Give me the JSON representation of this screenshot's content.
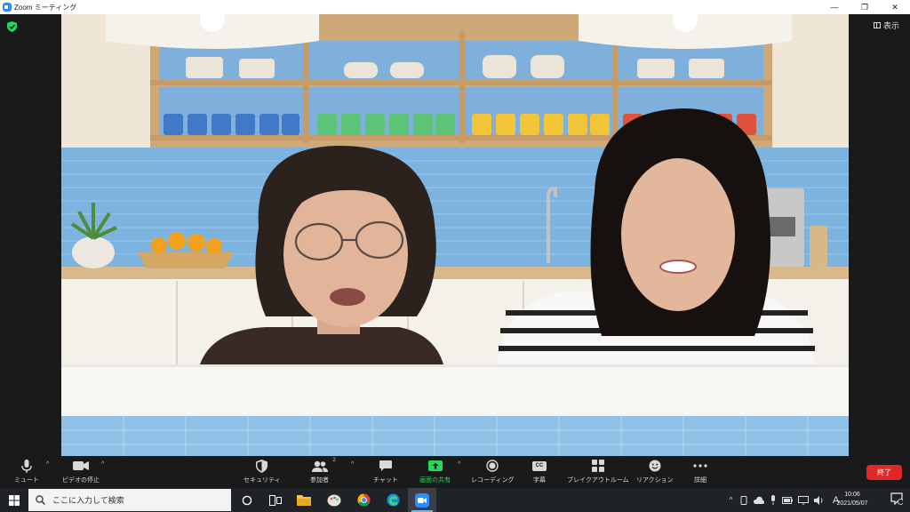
{
  "window": {
    "title": "Zoom ミーティング",
    "minimize": "—",
    "maximize": "❐",
    "close": "✕"
  },
  "meeting": {
    "view_label": "表示",
    "secure_icon": "shield-check-icon"
  },
  "toolbar": {
    "mute": "ミュート",
    "video_stop": "ビデオの停止",
    "security": "セキュリティ",
    "participants": "参加者",
    "participants_count": "2",
    "chat": "チャット",
    "share_screen": "画面の共有",
    "recording": "レコーディング",
    "captions": "字幕",
    "captions_badge": "CC",
    "breakout_rooms": "ブレイクアウトルーム",
    "reactions": "リアクション",
    "more": "詳細",
    "end": "終了"
  },
  "taskbar": {
    "search_placeholder": "ここに入力して検索",
    "ime": "A",
    "time": "10:06",
    "date": "2021/05/07"
  },
  "colors": {
    "end_red": "#e02828",
    "share_green": "#23d959",
    "zoom_blue": "#2d8cff"
  }
}
